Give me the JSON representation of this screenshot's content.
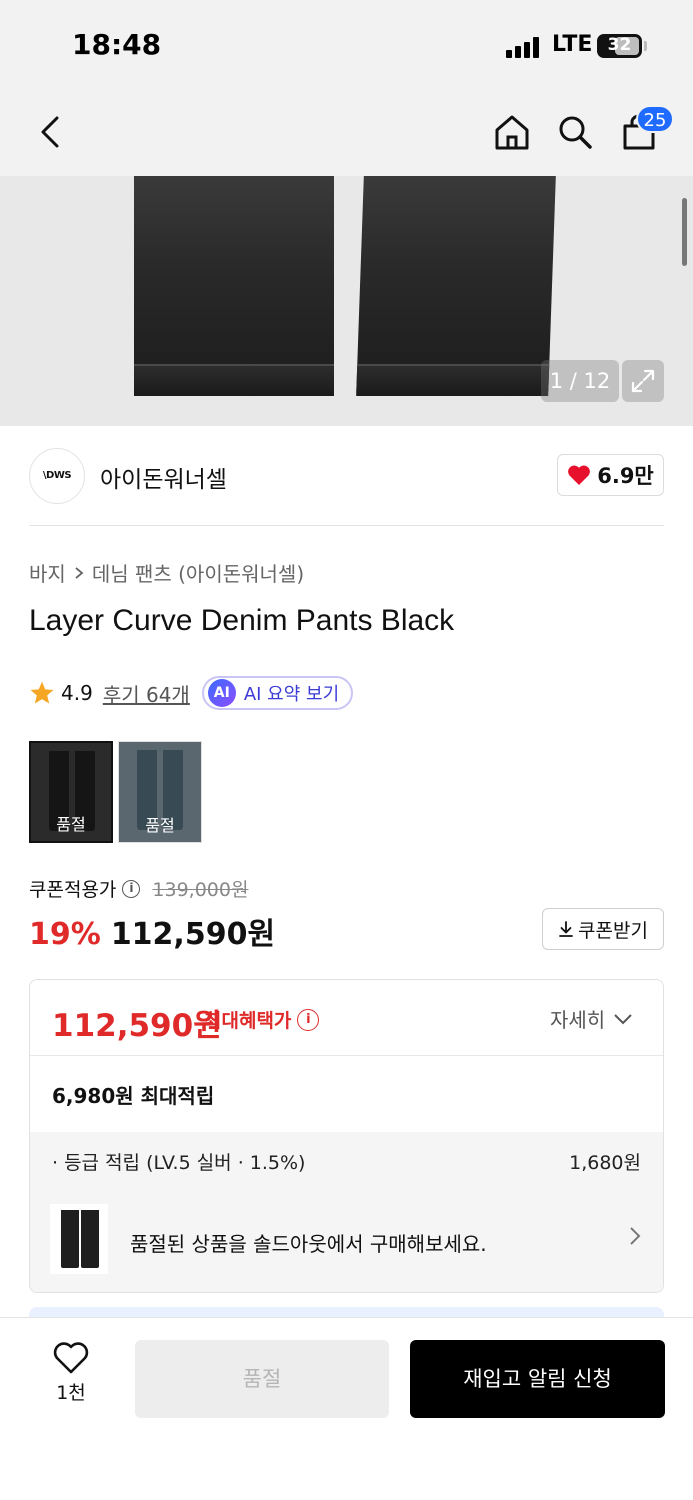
{
  "status_bar": {
    "time": "18:48",
    "network": "LTE",
    "battery": "32"
  },
  "header": {
    "cart_count": "25"
  },
  "gallery": {
    "counter": "1 / 12"
  },
  "brand": {
    "logo_text": "\\DWS",
    "name": "아이돈워너셀",
    "like_count": "6.9만"
  },
  "breadcrumb": {
    "category": "바지",
    "subcategory": "데님 팬츠 (아이돈워너셀)"
  },
  "product": {
    "title": "Layer Curve Denim Pants Black",
    "rating": "4.9",
    "review_link": "후기 64개",
    "ai_badge": "AI",
    "ai_summary_label": "AI 요약 보기"
  },
  "options": [
    {
      "label": "품절"
    },
    {
      "label": "품절"
    }
  ],
  "pricing": {
    "coupon_label": "쿠폰적용가",
    "original_price": "139,000원",
    "discount": "19%",
    "price": "112,590원",
    "coupon_button": "쿠폰받기"
  },
  "benefit": {
    "max_price": "112,590원",
    "max_label": "최대혜택가",
    "detail_toggle": "자세히",
    "points_line": "6,980원 최대적립",
    "grade_label": "· 등급 적립 (LV.5 실버 · 1.5%)",
    "grade_value": "1,680원",
    "banner_text": "품절된 상품을 솔드아웃에서 구매해보세요."
  },
  "bottom_bar": {
    "wish_count": "1천",
    "soldout_label": "품절",
    "restock_label": "재입고 알림 신청"
  },
  "colors": {
    "accent_red": "#e02a2a",
    "badge_blue": "#1f6bff",
    "ai_purple": "#3b3bd6"
  }
}
